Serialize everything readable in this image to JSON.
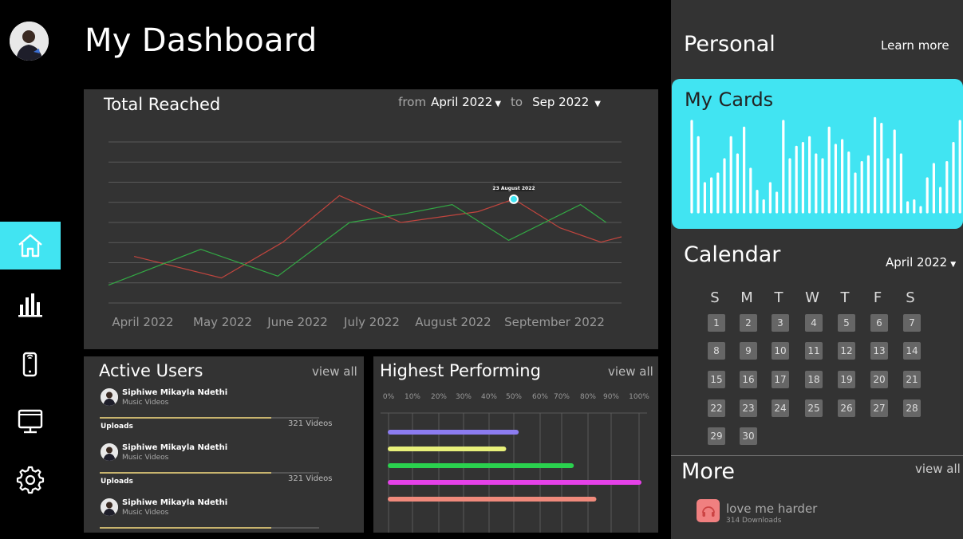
{
  "page_title": "My Dashboard",
  "sidebar": {
    "items": [
      {
        "name": "home",
        "icon": "home-icon",
        "active": true
      },
      {
        "name": "stats",
        "icon": "bar-chart-icon",
        "active": false
      },
      {
        "name": "mobile",
        "icon": "mobile-icon",
        "active": false
      },
      {
        "name": "desktop",
        "icon": "monitor-icon",
        "active": false
      },
      {
        "name": "settings",
        "icon": "gear-icon",
        "active": false
      }
    ],
    "accent": "#41e4f2"
  },
  "total_reached": {
    "title": "Total Reached",
    "from_label": "from",
    "from_value": "April 2022",
    "to_label": "to",
    "to_value": "Sep 2022",
    "tooltip": "23 August 2022"
  },
  "chart_data": {
    "type": "line",
    "categories": [
      "April 2022",
      "May 2022",
      "June 2022",
      "July 2022",
      "August 2022",
      "September 2022"
    ],
    "y_range": [
      0,
      9
    ],
    "grid": true,
    "series": [
      {
        "color": "#c0453e",
        "points": [
          [
            0.05,
            2.6
          ],
          [
            0.22,
            1.4
          ],
          [
            0.34,
            3.4
          ],
          [
            0.45,
            6.0
          ],
          [
            0.57,
            4.5
          ],
          [
            0.72,
            5.1
          ],
          [
            0.79,
            5.8
          ],
          [
            0.88,
            4.2
          ],
          [
            0.96,
            3.4
          ],
          [
            1.0,
            3.7
          ]
        ]
      },
      {
        "color": "#33a844",
        "points": [
          [
            0.0,
            1.0
          ],
          [
            0.18,
            3.0
          ],
          [
            0.33,
            1.5
          ],
          [
            0.47,
            4.5
          ],
          [
            0.58,
            5.0
          ],
          [
            0.67,
            5.5
          ],
          [
            0.78,
            3.5
          ],
          [
            0.92,
            5.5
          ],
          [
            0.97,
            4.5
          ]
        ]
      }
    ]
  },
  "active_users": {
    "title": "Active Users",
    "view_all": "view all",
    "rows": [
      {
        "name": "Siphiwe Mikayla Ndethi",
        "sub": "Music Videos",
        "uploads_label": "Uploads",
        "uploads_count": "321 Videos",
        "progress": 0.78
      },
      {
        "name": "Siphiwe Mikayla Ndethi",
        "sub": "Music Videos",
        "uploads_label": "Uploads",
        "uploads_count": "321 Videos",
        "progress": 0.78
      },
      {
        "name": "Siphiwe Mikayla Ndethi",
        "sub": "Music Videos",
        "progress": 0.78
      }
    ]
  },
  "highest_performing": {
    "title": "Highest Performing",
    "view_all": "view all",
    "ticks": [
      "0%",
      "10%",
      "20%",
      "30%",
      "40%",
      "50%",
      "60%",
      "70%",
      "80%",
      "90%",
      "100%"
    ],
    "bars": [
      {
        "value": 51,
        "color": "#8c7cf0"
      },
      {
        "value": 46,
        "color": "#e8f07a"
      },
      {
        "value": 73,
        "color": "#2ad14e"
      },
      {
        "value": 100,
        "color": "#e541e8"
      },
      {
        "value": 82,
        "color": "#f08a7c"
      }
    ]
  },
  "right_panel": {
    "personal_title": "Personal",
    "learn_more": "Learn more",
    "cards_title": "My Cards",
    "cards_bars": [
      0.95,
      0.78,
      0.3,
      0.35,
      0.4,
      0.55,
      0.78,
      0.6,
      0.88,
      0.45,
      0.22,
      0.12,
      0.3,
      0.2,
      0.95,
      0.55,
      0.68,
      0.72,
      0.78,
      0.6,
      0.55,
      0.88,
      0.7,
      0.75,
      0.62,
      0.4,
      0.52,
      0.58,
      0.98,
      0.92,
      0.55,
      0.85,
      0.6,
      0.1,
      0.12,
      0.05,
      0.35,
      0.5,
      0.25,
      0.52,
      0.72,
      0.95,
      0.98,
      0.86,
      0.6
    ]
  },
  "calendar": {
    "title": "Calendar",
    "month": "April 2022",
    "weekdays": [
      "S",
      "M",
      "T",
      "W",
      "T",
      "F",
      "S"
    ],
    "days": [
      "1",
      "2",
      "3",
      "4",
      "5",
      "6",
      "7",
      "8",
      "9",
      "10",
      "11",
      "12",
      "13",
      "14",
      "15",
      "16",
      "17",
      "18",
      "19",
      "20",
      "21",
      "22",
      "23",
      "24",
      "25",
      "26",
      "27",
      "28",
      "29",
      "30"
    ]
  },
  "more": {
    "title": "More",
    "view_all": "view all",
    "items": [
      {
        "name": "love me harder",
        "sub": "314 Downloads",
        "icon": "headphones-icon",
        "color": "#f08080"
      }
    ]
  }
}
